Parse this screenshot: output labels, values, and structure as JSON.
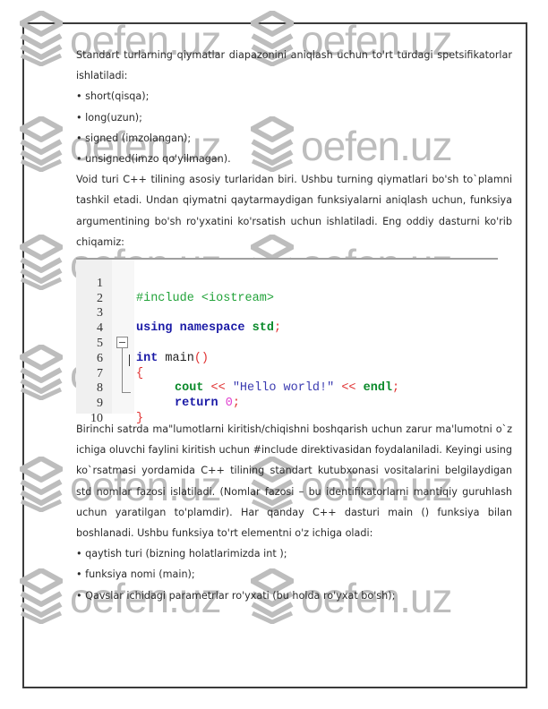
{
  "watermark": {
    "text": "oefen.uz",
    "icon": "layers-icon",
    "color": "#bdbdbd"
  },
  "intro": {
    "paragraph": "Standart turlarning qiymatlar diapazonini aniqlash uchun to'rt turdagi spetsifikatorlar ishlatiladi:",
    "items": [
      "• short(qisqa);",
      "• long(uzun);",
      "• signed (imzolangan);",
      "• unsigned(imzo qo'yilmagan)."
    ]
  },
  "void_paragraph": "Void turi C++ tilining asosiy turlaridan biri. Ushbu turning qiymatlari bo'sh to`plamni tashkil etadi. Undan qiymatni qaytarmaydigan funksiyalarni aniqlash uchun, funksiya argumentining bo'sh ro'yxatini ko'rsatish uchun ishlatiladi. Eng oddiy dasturni ko'rib chiqamiz:",
  "code": {
    "line_numbers": [
      "1",
      "2",
      "3",
      "4",
      "5",
      "6",
      "7",
      "8",
      "9",
      "10"
    ],
    "lines": {
      "l1_include": "#include <iostream>",
      "l3_using": "using namespace ",
      "l3_std": "std",
      "l3_semi": ";",
      "l5_int": "int",
      "l5_main": " main",
      "l5_parens": "()",
      "l6_brace": "{",
      "l7_cout": "cout",
      "l7_op1": " << ",
      "l7_str": "\"Hello world!\"",
      "l7_op2": " << ",
      "l7_endl": "endl",
      "l7_semi": ";",
      "l8_return": "return",
      "l8_zero": " 0",
      "l8_semi": ";",
      "l9_brace": "}"
    }
  },
  "explain": {
    "paragraph": "Birinchi satrda ma\"lumotlarni kiritish/chiqishni boshqarish uchun zarur ma'lumotni o`z ichiga oluvchi faylini kiritish uchun #include direktivasidan foydalaniladi. Keyingi using ko`rsatmasi yordamida C++ tilining standart kutubxonasi vositalarini belgilaydigan std nomlar fazosi islatiladi. (Nomlar fazosi – bu identifikatorlarni mantiqiy guruhlash uchun yaratilgan to'plamdir). Har qanday C++ dasturi main () funksiya bilan boshlanadi. Ushbu funksiya to'rt elementni o'z ichiga oladi:",
    "items": [
      "• qaytish turi (bizning holatlarimizda int );",
      "• funksiya nomi (main);",
      "• Qavslar ichidagi parametrlar ro'yxati (bu holda ro'yxat bo'sh);"
    ]
  }
}
